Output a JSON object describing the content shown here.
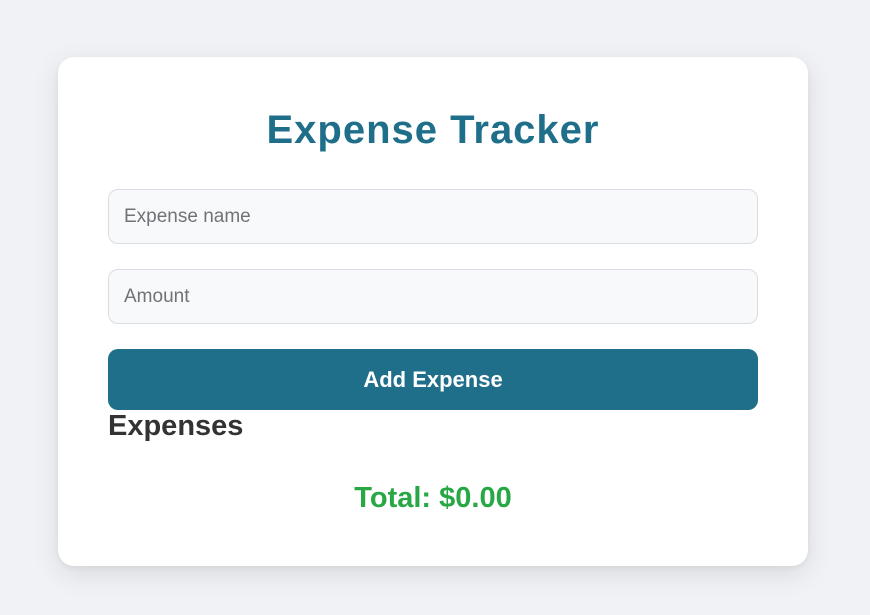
{
  "app": {
    "title": "Expense Tracker"
  },
  "form": {
    "name_input": {
      "value": "",
      "placeholder": "Expense name"
    },
    "amount_input": {
      "value": "",
      "placeholder": "Amount"
    },
    "add_label": "Add Expense"
  },
  "expenses": {
    "heading": "Expenses",
    "items": []
  },
  "summary": {
    "total_text": "Total: $0.00"
  },
  "colors": {
    "accent": "#1f6f8b",
    "total": "#28a745",
    "heading_text": "#333333",
    "background": "#f0f2f5",
    "card": "#ffffff"
  }
}
